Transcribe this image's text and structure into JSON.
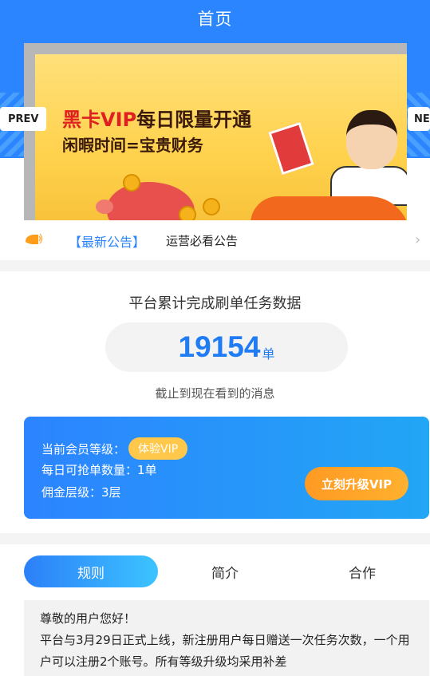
{
  "header": {
    "title": "首页"
  },
  "carousel": {
    "prev_label": "PREV",
    "next_label": "NEXT",
    "slide": {
      "title_red": "黑卡VIP",
      "title_dark": "每日限量开通",
      "subtitle": "闲暇时间=宝贵财务"
    }
  },
  "notice": {
    "tag": "【最新公告】",
    "text": "运营必看公告"
  },
  "stats": {
    "caption": "平台累计完成刷单任务数据",
    "count": "19154",
    "unit": "单",
    "note": "截止到现在看到的消息"
  },
  "vip": {
    "level_label": "当前会员等级：",
    "level_value": "体验VIP",
    "daily_quota": "每日可抢单数量：1单",
    "commission_levels": "佣金层级：3层",
    "upgrade_label": "立刻升级VIP"
  },
  "tabs": [
    {
      "label": "规则",
      "active": true
    },
    {
      "label": "简介",
      "active": false
    },
    {
      "label": "合作",
      "active": false
    }
  ],
  "rules": {
    "greeting": "尊敬的用户您好！",
    "body": "平台与3月29日正式上线，新注册用户每日赠送一次任务次数，一个用户可以注册2个账号。所有等级升级均采用补差"
  },
  "colors": {
    "primary": "#2b85ff",
    "accent_orange": "#ffa726",
    "badge_yellow": "#ffc84a"
  }
}
